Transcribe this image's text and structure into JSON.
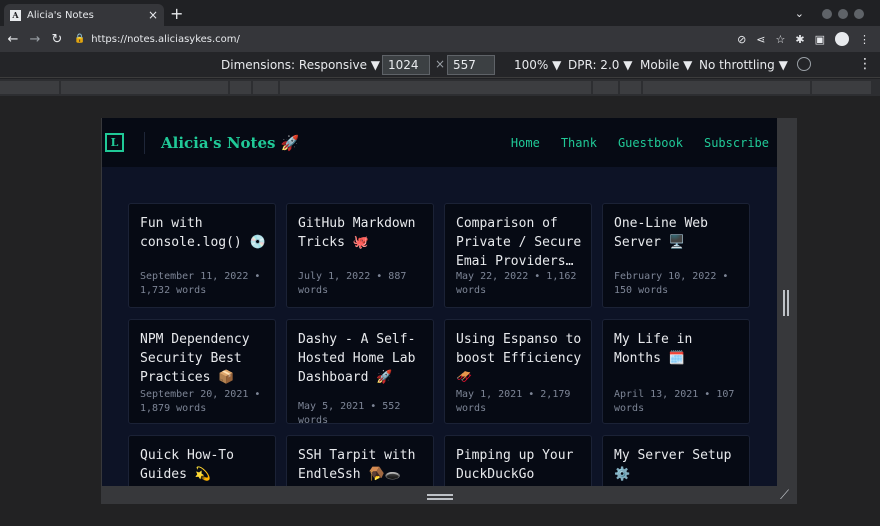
{
  "browser": {
    "tab_title": "Alicia's Notes",
    "favicon_letter": "A",
    "url": "https://notes.aliciasykes.com/"
  },
  "devtools": {
    "dimensions_label": "Dimensions: Responsive ▼",
    "width": "1024",
    "height": "557",
    "zoom": "100% ▼",
    "dpr": "DPR: 2.0 ▼",
    "device_type": "Mobile ▼",
    "throttling": "No throttling ▼"
  },
  "site": {
    "logo_letter": "L",
    "title": "Alicia's Notes 🚀",
    "nav": [
      "Home",
      "Thank",
      "Guestbook",
      "Subscribe"
    ]
  },
  "posts": [
    {
      "title": "Fun with console.log() 💿",
      "meta": "September 11, 2022 • 1,732 words"
    },
    {
      "title": "GitHub Markdown Tricks 🐙",
      "meta": "July 1, 2022 • 887 words"
    },
    {
      "title": "Comparison of Private / Secure Emai Providers…",
      "meta": "May 22, 2022 • 1,162 words"
    },
    {
      "title": "One-Line Web Server 🖥️",
      "meta": "February 10, 2022 • 150 words"
    },
    {
      "title": "NPM Dependency Security Best Practices 📦",
      "meta": "September 20, 2021 • 1,879 words"
    },
    {
      "title": "Dashy - A Self-Hosted Home Lab Dashboard 🚀",
      "meta": "May 5, 2021 • 552 words"
    },
    {
      "title": "Using Espanso to boost Efficiency 🛷",
      "meta": "May 1, 2021 • 2,179 words"
    },
    {
      "title": "My Life in Months 🗓️",
      "meta": "April 13, 2021 • 107 words"
    },
    {
      "title": "Quick How-To Guides 💫",
      "meta": ""
    },
    {
      "title": "SSH Tarpit with EndleSsh 🪤🕳️",
      "meta": ""
    },
    {
      "title": "Pimping up Your DuckDuckGo",
      "meta": ""
    },
    {
      "title": "My Server Setup ⚙️",
      "meta": ""
    }
  ]
}
